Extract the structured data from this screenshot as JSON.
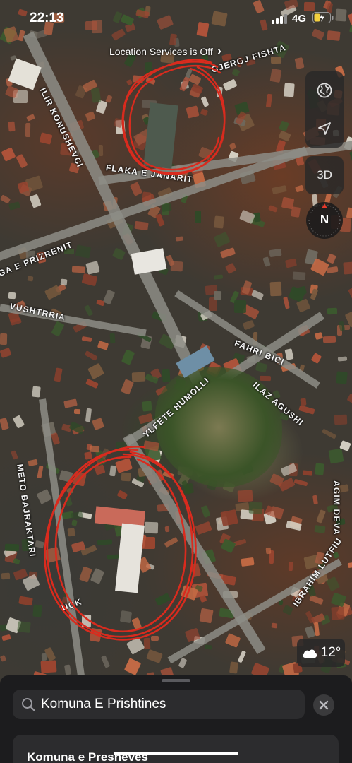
{
  "status_bar": {
    "time": "22:13",
    "network": "4G"
  },
  "location_banner": {
    "text": "Location Services is Off",
    "chevron": "›"
  },
  "map": {
    "street_labels": [
      "GJERGJ FISHTA",
      "ILIR KONUSHEVCI",
      "FLAKA E JANARIT",
      "RUGA E PRIZRENIT",
      "VUSHTRRIA",
      "FAHRI BICI",
      "ILAZ AGUSHI",
      "YLFETE HUMOLLI",
      "METO BAJRAKTARI",
      "AGIM DEVA",
      "IBRAHIM LUTFIU",
      "UÇK"
    ],
    "annotation_color": "#d92b1e"
  },
  "controls": {
    "globe_icon": "globe-icon",
    "location_icon": "location-arrow-icon",
    "view_3d_label": "3D",
    "compass_letter": "N"
  },
  "weather": {
    "icon": "cloud-icon",
    "temperature": "12°"
  },
  "search": {
    "query": "Komuna E Prishtines"
  },
  "results": [
    {
      "title": "Komuna e Preshevës"
    }
  ]
}
